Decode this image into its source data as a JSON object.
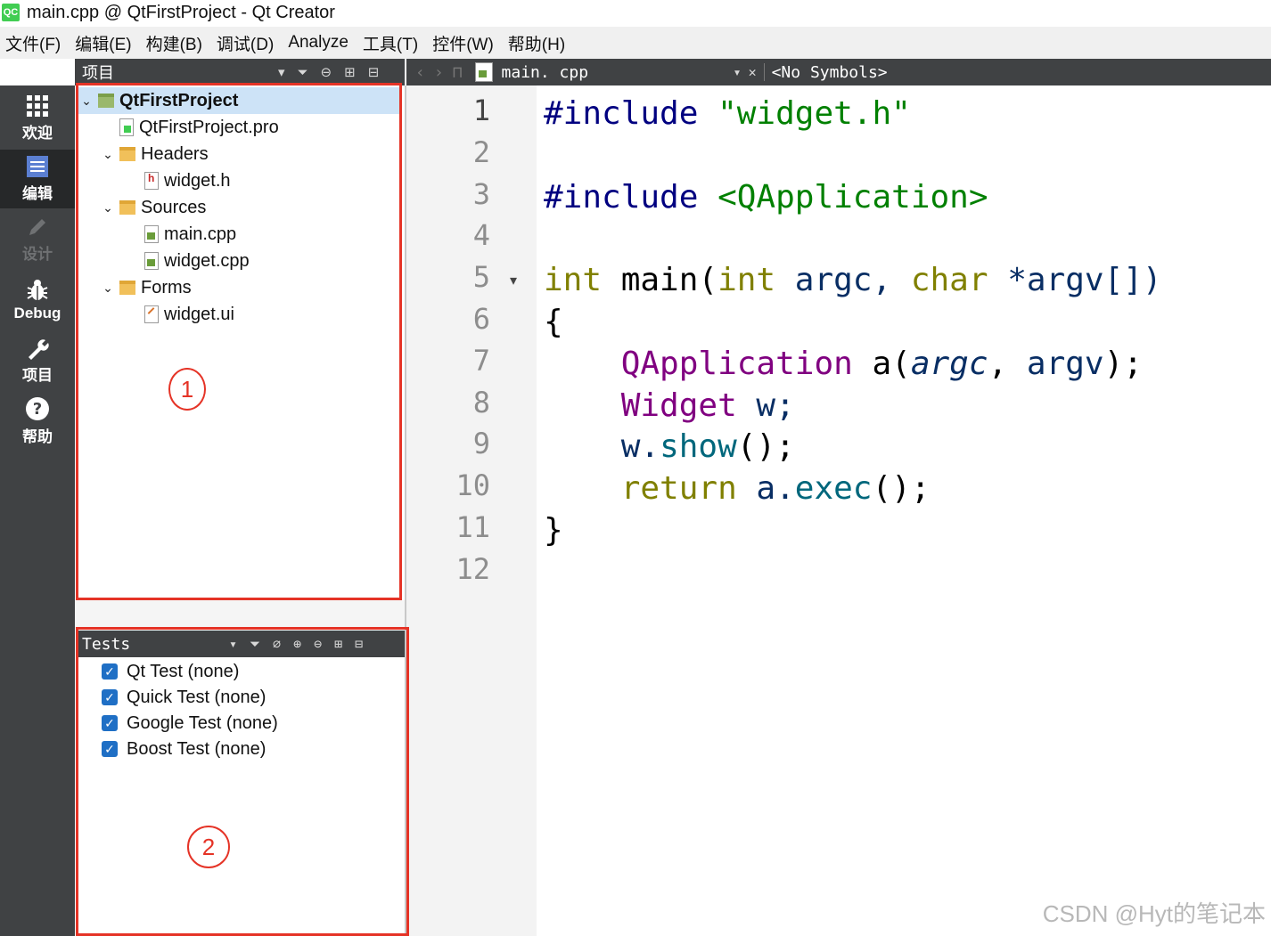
{
  "window": {
    "title": "main.cpp @ QtFirstProject - Qt Creator",
    "logo_text": "QC"
  },
  "menu": [
    "文件(F)",
    "编辑(E)",
    "构建(B)",
    "调试(D)",
    "Analyze",
    "工具(T)",
    "控件(W)",
    "帮助(H)"
  ],
  "modes": [
    {
      "label": "欢迎",
      "icon": "grid-icon"
    },
    {
      "label": "编辑",
      "icon": "edit-icon",
      "active": true
    },
    {
      "label": "设计",
      "icon": "pencil-icon",
      "disabled": true
    },
    {
      "label": "Debug",
      "icon": "bug-icon"
    },
    {
      "label": "项目",
      "icon": "wrench-icon"
    },
    {
      "label": "帮助",
      "icon": "help-icon"
    }
  ],
  "project_panel": {
    "title": "项目",
    "tree": [
      {
        "label": "QtFirstProject",
        "level": 0,
        "type": "project",
        "expanded": true,
        "selected": true
      },
      {
        "label": "QtFirstProject.pro",
        "level": 1,
        "type": "pro"
      },
      {
        "label": "Headers",
        "level": 1,
        "type": "folder",
        "expanded": true
      },
      {
        "label": "widget.h",
        "level": 2,
        "type": "h"
      },
      {
        "label": "Sources",
        "level": 1,
        "type": "folder",
        "expanded": true
      },
      {
        "label": "main.cpp",
        "level": 2,
        "type": "cpp"
      },
      {
        "label": "widget.cpp",
        "level": 2,
        "type": "cpp"
      },
      {
        "label": "Forms",
        "level": 1,
        "type": "folder",
        "expanded": true
      },
      {
        "label": "widget.ui",
        "level": 2,
        "type": "ui"
      }
    ]
  },
  "tests_panel": {
    "title": "Tests",
    "items": [
      "Qt Test (none)",
      "Quick Test (none)",
      "Google Test (none)",
      "Boost Test (none)"
    ]
  },
  "editor": {
    "file_name": "main. cpp",
    "symbols": "<No Symbols>",
    "line_numbers": [
      "1",
      "2",
      "3",
      "4",
      "5",
      "6",
      "7",
      "8",
      "9",
      "10",
      "11",
      "12"
    ],
    "lines": [
      [
        [
          "#include ",
          "pre"
        ],
        [
          "\"widget.h\"",
          "str"
        ]
      ],
      [],
      [
        [
          "#include ",
          "pre"
        ],
        [
          "<QApplication>",
          "str"
        ]
      ],
      [],
      [
        [
          "int ",
          "kw"
        ],
        [
          "main(",
          ""
        ],
        [
          "int ",
          "kw"
        ],
        [
          "argc, ",
          "var"
        ],
        [
          "char ",
          "kw"
        ],
        [
          "*argv[])",
          "var"
        ]
      ],
      [
        [
          "{",
          ""
        ]
      ],
      [
        [
          "    ",
          ""
        ],
        [
          "QApplication ",
          "cls"
        ],
        [
          "a(",
          ""
        ],
        [
          "argc",
          "param"
        ],
        [
          ", ",
          ""
        ],
        [
          "argv",
          "var"
        ],
        [
          ");",
          ""
        ]
      ],
      [
        [
          "    ",
          ""
        ],
        [
          "Widget ",
          "cls"
        ],
        [
          "w;",
          "var"
        ]
      ],
      [
        [
          "    ",
          ""
        ],
        [
          "w.",
          "var"
        ],
        [
          "show",
          "fn"
        ],
        [
          "();",
          ""
        ]
      ],
      [
        [
          "    ",
          ""
        ],
        [
          "return ",
          "kw"
        ],
        [
          "a.",
          "var"
        ],
        [
          "exec",
          "fn"
        ],
        [
          "();",
          ""
        ]
      ],
      [
        [
          "}",
          ""
        ]
      ],
      []
    ]
  },
  "annotations": {
    "marker1": "1",
    "marker2": "2"
  },
  "watermark": "CSDN @Hyt的笔记本"
}
